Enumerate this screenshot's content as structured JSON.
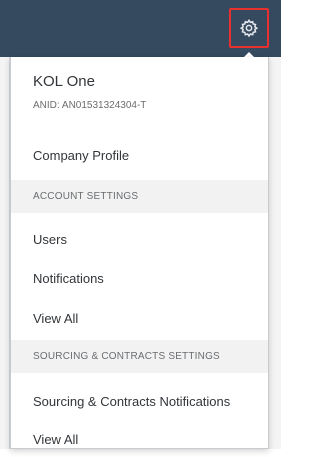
{
  "header": {
    "settings_icon": "gear-icon",
    "highlight_color": "#e8302f",
    "bar_color": "#354a5f"
  },
  "menu": {
    "org_name": "KOL One",
    "org_anid": "ANID: AN01531324304-T",
    "company_profile": "Company Profile",
    "account_settings_header": "ACCOUNT SETTINGS",
    "account_items": [
      "Users",
      "Notifications",
      "View All"
    ],
    "sourcing_header": "SOURCING & CONTRACTS SETTINGS",
    "sourcing_items": [
      "Sourcing & Contracts Notifications",
      "View All"
    ]
  }
}
